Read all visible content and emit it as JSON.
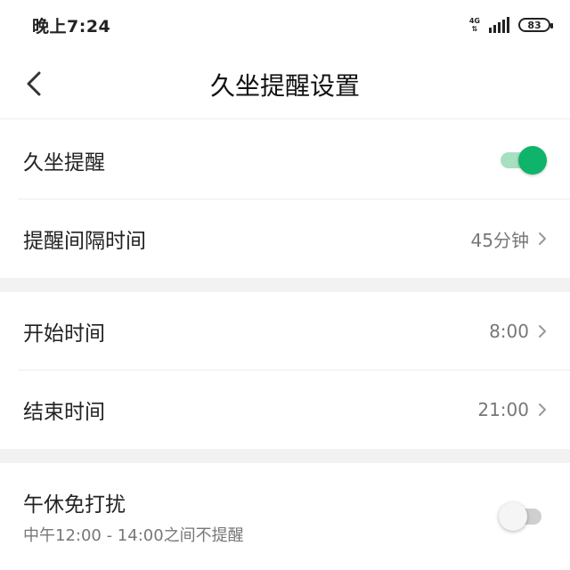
{
  "status": {
    "time": "晚上7:24",
    "network": "4G",
    "battery": "83"
  },
  "header": {
    "title": "久坐提醒设置",
    "back_icon": "chevron-left-icon"
  },
  "colors": {
    "accent": "#0fb36a",
    "accent_track": "#a6e0c1",
    "section_gap": "#f2f2f2"
  },
  "sections": [
    {
      "rows": [
        {
          "label": "久坐提醒",
          "control": "toggle",
          "enabled": true
        },
        {
          "label": "提醒间隔时间",
          "value": "45分钟",
          "control": "chevron"
        }
      ]
    },
    {
      "rows": [
        {
          "label": "开始时间",
          "value": "8:00",
          "control": "chevron"
        },
        {
          "label": "结束时间",
          "value": "21:00",
          "control": "chevron"
        }
      ]
    },
    {
      "rows": [
        {
          "label": "午休免打扰",
          "sublabel": "中午12:00 - 14:00之间不提醒",
          "control": "toggle",
          "enabled": false
        }
      ]
    }
  ]
}
